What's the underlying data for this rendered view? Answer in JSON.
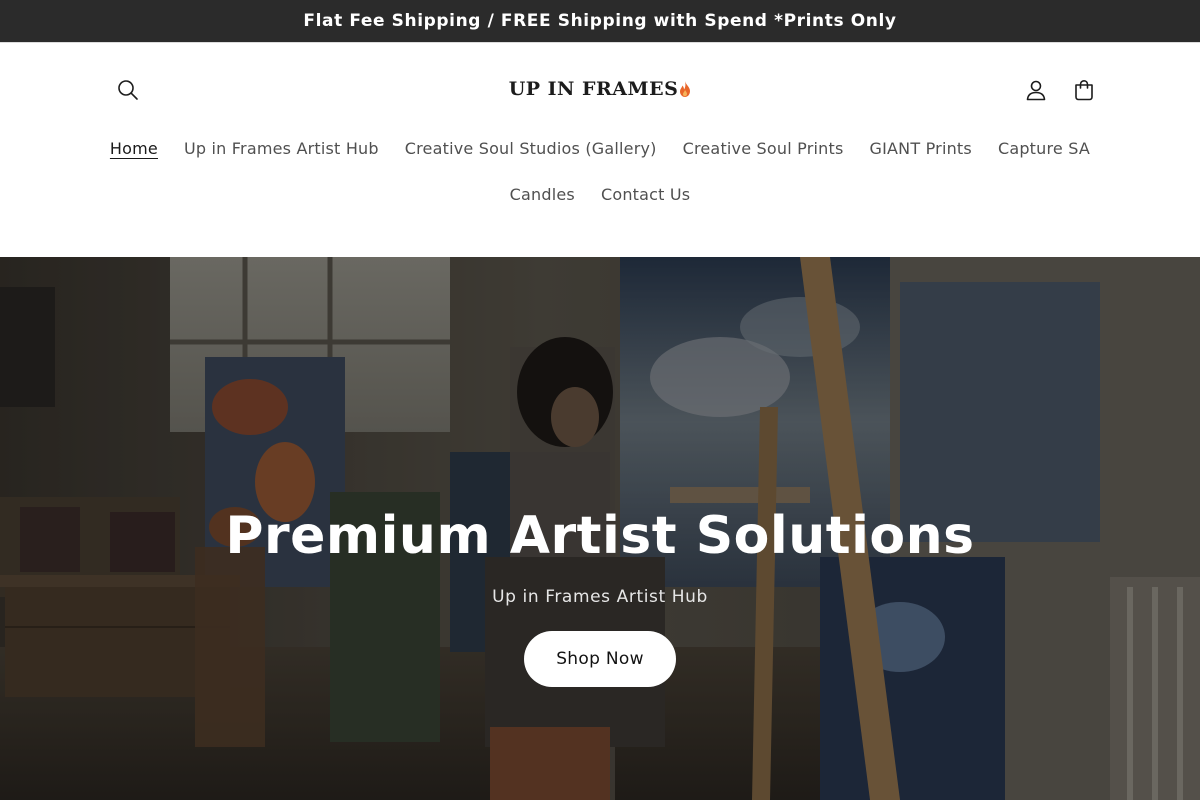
{
  "announcement": {
    "text": "Flat Fee Shipping / FREE Shipping with Spend *Prints Only"
  },
  "header": {
    "logo_text": "UP IN FRAMES",
    "icons": {
      "search": "search-icon",
      "account": "account-icon",
      "cart": "cart-icon",
      "logo_mark": "flame-icon"
    }
  },
  "nav": {
    "row1": [
      {
        "label": "Home"
      },
      {
        "label": "Up in Frames Artist Hub"
      },
      {
        "label": "Creative Soul Studios (Gallery)"
      },
      {
        "label": "Creative Soul Prints"
      },
      {
        "label": "GIANT Prints"
      },
      {
        "label": "Capture SA"
      }
    ],
    "row2": [
      {
        "label": "Candles"
      },
      {
        "label": "Contact Us"
      }
    ],
    "active": "Home"
  },
  "hero": {
    "title": "Premium Artist Solutions",
    "subtitle": "Up in Frames Artist Hub",
    "button_label": "Shop Now"
  },
  "colors": {
    "announcement_bg": "#2b2b2b",
    "accent_flame": "#e8662a",
    "nav_text": "#505050",
    "hero_overlay": "rgba(0,0,0,0.32)"
  }
}
